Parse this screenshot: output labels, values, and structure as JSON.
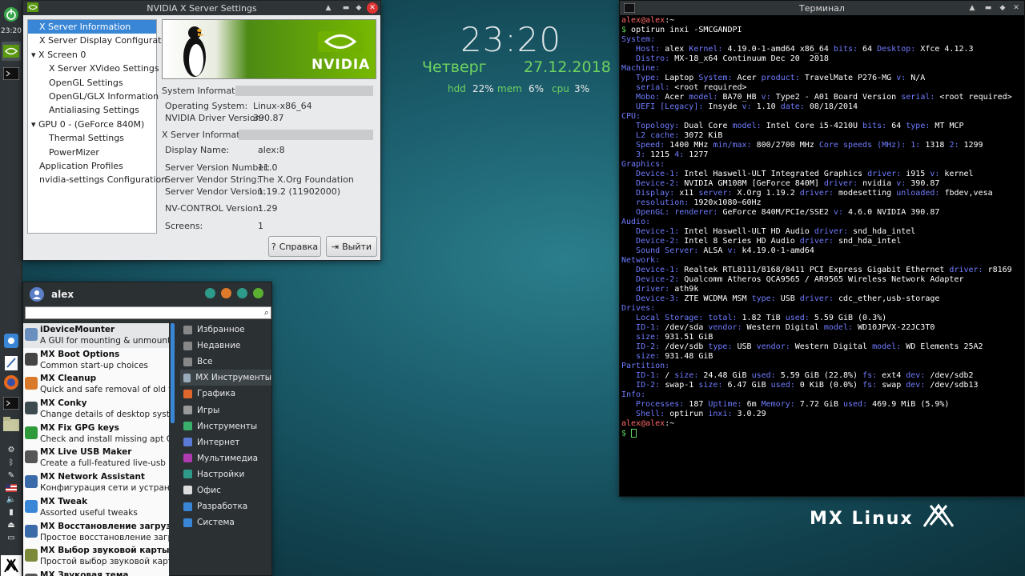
{
  "panel": {
    "clock": "23:20"
  },
  "nvidia": {
    "title": "NVIDIA X Server Settings",
    "tree": [
      {
        "label": "X Server Information",
        "indent": 0,
        "exp": "",
        "sel": true
      },
      {
        "label": "X Server Display Configuration",
        "indent": 0,
        "exp": ""
      },
      {
        "label": "X Screen 0",
        "indent": 0,
        "exp": "▾"
      },
      {
        "label": "X Server XVideo Settings",
        "indent": 2,
        "exp": ""
      },
      {
        "label": "OpenGL Settings",
        "indent": 2,
        "exp": ""
      },
      {
        "label": "OpenGL/GLX Information",
        "indent": 2,
        "exp": ""
      },
      {
        "label": "Antialiasing Settings",
        "indent": 2,
        "exp": ""
      },
      {
        "label": "GPU 0 - (GeForce 840M)",
        "indent": 0,
        "exp": "▾"
      },
      {
        "label": "Thermal Settings",
        "indent": 2,
        "exp": ""
      },
      {
        "label": "PowerMizer",
        "indent": 2,
        "exp": ""
      },
      {
        "label": "Application Profiles",
        "indent": 0,
        "exp": ""
      },
      {
        "label": "nvidia-settings Configuration",
        "indent": 0,
        "exp": ""
      }
    ],
    "banner_text": "NVIDIA",
    "sys_section": "System Information",
    "xs_section": "X Server Information",
    "rows": {
      "os_l": "Operating System:",
      "os_v": "Linux-x86_64",
      "drv_l": "NVIDIA Driver Version:",
      "drv_v": "390.87",
      "disp_l": "Display Name:",
      "disp_v": "alex:8",
      "svn_l": "Server Version Number:",
      "svn_v": "11.0",
      "svs_l": "Server Vendor String:",
      "svs_v": "The X.Org Foundation",
      "svv_l": "Server Vendor Version:",
      "svv_v": "1.19.2 (11902000)",
      "nvc_l": "NV-CONTROL Version:",
      "nvc_v": "1.29",
      "scr_l": "Screens:",
      "scr_v": "1"
    },
    "help_btn": "Справка",
    "quit_btn": "Выйти"
  },
  "conky": {
    "time": "23:20",
    "day": "Четверг",
    "date": "27.12.2018",
    "hdd_l": "hdd",
    "hdd_v": "22%",
    "mem_l": "mem",
    "mem_v": "6%",
    "cpu_l": "cpu",
    "cpu_v": "3%"
  },
  "terminal": {
    "title": "Терминал",
    "lines": [
      [
        [
          "u",
          "alex@alex"
        ],
        [
          "w",
          ":~"
        ]
      ],
      [
        [
          "g",
          "$ "
        ],
        [
          "w",
          "optirun inxi -SMCGANDPI"
        ]
      ],
      [
        [
          "k",
          "System:"
        ]
      ],
      [
        [
          "k",
          "   Host: "
        ],
        [
          "w",
          "alex "
        ],
        [
          "k",
          "Kernel: "
        ],
        [
          "w",
          "4.19.0-1-amd64 x86_64 "
        ],
        [
          "k",
          "bits: "
        ],
        [
          "w",
          "64 "
        ],
        [
          "k",
          "Desktop: "
        ],
        [
          "w",
          "Xfce 4.12.3"
        ]
      ],
      [
        [
          "k",
          "   Distro: "
        ],
        [
          "w",
          "MX-18_x64 Continuum Dec 20  2018"
        ]
      ],
      [
        [
          "k",
          "Machine:"
        ]
      ],
      [
        [
          "k",
          "   Type: "
        ],
        [
          "w",
          "Laptop "
        ],
        [
          "k",
          "System: "
        ],
        [
          "w",
          "Acer "
        ],
        [
          "k",
          "product: "
        ],
        [
          "w",
          "TravelMate P276-MG "
        ],
        [
          "k",
          "v: "
        ],
        [
          "w",
          "N/A"
        ]
      ],
      [
        [
          "k",
          "   serial: "
        ],
        [
          "w",
          "<root required>"
        ]
      ],
      [
        [
          "k",
          "   Mobo: "
        ],
        [
          "w",
          "Acer "
        ],
        [
          "k",
          "model: "
        ],
        [
          "w",
          "BA70_HB "
        ],
        [
          "k",
          "v: "
        ],
        [
          "w",
          "Type2 - A01 Board Version "
        ],
        [
          "k",
          "serial: "
        ],
        [
          "w",
          "<root required>"
        ]
      ],
      [
        [
          "k",
          "   UEFI [Legacy]: "
        ],
        [
          "w",
          "Insyde "
        ],
        [
          "k",
          "v: "
        ],
        [
          "w",
          "1.10 "
        ],
        [
          "k",
          "date: "
        ],
        [
          "w",
          "08/18/2014"
        ]
      ],
      [
        [
          "k",
          "CPU:"
        ]
      ],
      [
        [
          "k",
          "   Topology: "
        ],
        [
          "w",
          "Dual Core "
        ],
        [
          "k",
          "model: "
        ],
        [
          "w",
          "Intel Core i5-4210U "
        ],
        [
          "k",
          "bits: "
        ],
        [
          "w",
          "64 "
        ],
        [
          "k",
          "type: "
        ],
        [
          "w",
          "MT MCP"
        ]
      ],
      [
        [
          "k",
          "   L2 cache: "
        ],
        [
          "w",
          "3072 KiB"
        ]
      ],
      [
        [
          "k",
          "   Speed: "
        ],
        [
          "w",
          "1400 MHz "
        ],
        [
          "k",
          "min/max: "
        ],
        [
          "w",
          "800/2700 MHz "
        ],
        [
          "k",
          "Core speeds (MHz): 1: "
        ],
        [
          "w",
          "1318 "
        ],
        [
          "k",
          "2: "
        ],
        [
          "w",
          "1299"
        ]
      ],
      [
        [
          "k",
          "   3: "
        ],
        [
          "w",
          "1215 "
        ],
        [
          "k",
          "4: "
        ],
        [
          "w",
          "1277"
        ]
      ],
      [
        [
          "k",
          "Graphics:"
        ]
      ],
      [
        [
          "k",
          "   Device-1: "
        ],
        [
          "w",
          "Intel Haswell-ULT Integrated Graphics "
        ],
        [
          "k",
          "driver: "
        ],
        [
          "w",
          "i915 "
        ],
        [
          "k",
          "v: "
        ],
        [
          "w",
          "kernel"
        ]
      ],
      [
        [
          "k",
          "   Device-2: "
        ],
        [
          "w",
          "NVIDIA GM108M [GeForce 840M] "
        ],
        [
          "k",
          "driver: "
        ],
        [
          "w",
          "nvidia "
        ],
        [
          "k",
          "v: "
        ],
        [
          "w",
          "390.87"
        ]
      ],
      [
        [
          "k",
          "   Display: "
        ],
        [
          "w",
          "x11 "
        ],
        [
          "k",
          "server: "
        ],
        [
          "w",
          "X.Org 1.19.2 "
        ],
        [
          "k",
          "driver: "
        ],
        [
          "w",
          "modesetting "
        ],
        [
          "k",
          "unloaded: "
        ],
        [
          "w",
          "fbdev,vesa"
        ]
      ],
      [
        [
          "k",
          "   resolution: "
        ],
        [
          "w",
          "1920x1080~60Hz"
        ]
      ],
      [
        [
          "k",
          "   OpenGL: renderer: "
        ],
        [
          "w",
          "GeForce 840M/PCIe/SSE2 "
        ],
        [
          "k",
          "v: "
        ],
        [
          "w",
          "4.6.0 NVIDIA 390.87"
        ]
      ],
      [
        [
          "k",
          "Audio:"
        ]
      ],
      [
        [
          "k",
          "   Device-1: "
        ],
        [
          "w",
          "Intel Haswell-ULT HD Audio "
        ],
        [
          "k",
          "driver: "
        ],
        [
          "w",
          "snd_hda_intel"
        ]
      ],
      [
        [
          "k",
          "   Device-2: "
        ],
        [
          "w",
          "Intel 8 Series HD Audio "
        ],
        [
          "k",
          "driver: "
        ],
        [
          "w",
          "snd_hda_intel"
        ]
      ],
      [
        [
          "k",
          "   Sound Server: "
        ],
        [
          "w",
          "ALSA "
        ],
        [
          "k",
          "v: "
        ],
        [
          "w",
          "k4.19.0-1-amd64"
        ]
      ],
      [
        [
          "k",
          "Network:"
        ]
      ],
      [
        [
          "k",
          "   Device-1: "
        ],
        [
          "w",
          "Realtek RTL8111/8168/8411 PCI Express Gigabit Ethernet "
        ],
        [
          "k",
          "driver: "
        ],
        [
          "w",
          "r8169"
        ]
      ],
      [
        [
          "k",
          "   Device-2: "
        ],
        [
          "w",
          "Qualcomm Atheros QCA9565 / AR9565 Wireless Network Adapter"
        ]
      ],
      [
        [
          "k",
          "   driver: "
        ],
        [
          "w",
          "ath9k"
        ]
      ],
      [
        [
          "k",
          "   Device-3: "
        ],
        [
          "w",
          "ZTE WCDMA MSM "
        ],
        [
          "k",
          "type: "
        ],
        [
          "w",
          "USB "
        ],
        [
          "k",
          "driver: "
        ],
        [
          "w",
          "cdc_ether,usb-storage"
        ]
      ],
      [
        [
          "k",
          "Drives:"
        ]
      ],
      [
        [
          "k",
          "   Local Storage: total: "
        ],
        [
          "w",
          "1.82 TiB "
        ],
        [
          "k",
          "used: "
        ],
        [
          "w",
          "5.59 GiB (0.3%)"
        ]
      ],
      [
        [
          "k",
          "   ID-1: "
        ],
        [
          "w",
          "/dev/sda "
        ],
        [
          "k",
          "vendor: "
        ],
        [
          "w",
          "Western Digital "
        ],
        [
          "k",
          "model: "
        ],
        [
          "w",
          "WD10JPVX-22JC3T0"
        ]
      ],
      [
        [
          "k",
          "   size: "
        ],
        [
          "w",
          "931.51 GiB"
        ]
      ],
      [
        [
          "k",
          "   ID-2: "
        ],
        [
          "w",
          "/dev/sdb "
        ],
        [
          "k",
          "type: "
        ],
        [
          "w",
          "USB "
        ],
        [
          "k",
          "vendor: "
        ],
        [
          "w",
          "Western Digital "
        ],
        [
          "k",
          "model: "
        ],
        [
          "w",
          "WD Elements 25A2"
        ]
      ],
      [
        [
          "k",
          "   size: "
        ],
        [
          "w",
          "931.48 GiB"
        ]
      ],
      [
        [
          "k",
          "Partition:"
        ]
      ],
      [
        [
          "k",
          "   ID-1: "
        ],
        [
          "w",
          "/ "
        ],
        [
          "k",
          "size: "
        ],
        [
          "w",
          "24.48 GiB "
        ],
        [
          "k",
          "used: "
        ],
        [
          "w",
          "5.59 GiB (22.8%) "
        ],
        [
          "k",
          "fs: "
        ],
        [
          "w",
          "ext4 "
        ],
        [
          "k",
          "dev: "
        ],
        [
          "w",
          "/dev/sdb2"
        ]
      ],
      [
        [
          "k",
          "   ID-2: "
        ],
        [
          "w",
          "swap-1 "
        ],
        [
          "k",
          "size: "
        ],
        [
          "w",
          "6.47 GiB "
        ],
        [
          "k",
          "used: "
        ],
        [
          "w",
          "0 KiB (0.0%) "
        ],
        [
          "k",
          "fs: "
        ],
        [
          "w",
          "swap "
        ],
        [
          "k",
          "dev: "
        ],
        [
          "w",
          "/dev/sdb13"
        ]
      ],
      [
        [
          "k",
          "Info:"
        ]
      ],
      [
        [
          "k",
          "   Processes: "
        ],
        [
          "w",
          "187 "
        ],
        [
          "k",
          "Uptime: "
        ],
        [
          "w",
          "6m "
        ],
        [
          "k",
          "Memory: "
        ],
        [
          "w",
          "7.72 GiB "
        ],
        [
          "k",
          "used: "
        ],
        [
          "w",
          "469.9 MiB (5.9%)"
        ]
      ],
      [
        [
          "k",
          "   Shell: "
        ],
        [
          "w",
          "optirun "
        ],
        [
          "k",
          "inxi: "
        ],
        [
          "w",
          "3.0.29"
        ]
      ],
      [
        [
          "u",
          "alex@alex"
        ],
        [
          "w",
          ":~"
        ]
      ],
      [
        [
          "g",
          "$ "
        ]
      ]
    ]
  },
  "menu": {
    "user": "alex",
    "search_placeholder": "",
    "apps": [
      {
        "name": "iDeviceMounter",
        "desc": "A GUI for mounting & unmounting...",
        "icon": "#6a8fbf"
      },
      {
        "name": "MX Boot Options",
        "desc": "Common start-up choices",
        "icon": "#444"
      },
      {
        "name": "MX Cleanup",
        "desc": "Quick and safe removal of old files",
        "icon": "#d97a2b"
      },
      {
        "name": "MX Conky",
        "desc": "Change details of desktop system...",
        "icon": "#3d4a4f"
      },
      {
        "name": "MX Fix GPG keys",
        "desc": "Check and install missing apt GP...",
        "icon": "#2e9a3a"
      },
      {
        "name": "MX Live USB Maker",
        "desc": "Create a full-featured live-usb",
        "icon": "#555"
      },
      {
        "name": "MX Network Assistant",
        "desc": "Конфигурация сети и устранени...",
        "icon": "#3a6aa8"
      },
      {
        "name": "MX Tweak",
        "desc": "Assorted useful tweaks",
        "icon": "#3a86d6"
      },
      {
        "name": "MX Восстановление загрузчика",
        "desc": "Простое восстановление загруз...",
        "icon": "#3a6aa8"
      },
      {
        "name": "MX Выбор звуковой карты",
        "desc": "Простой выбор звуковой карты ...",
        "icon": "#7a8a3a"
      },
      {
        "name": "MX Звуковая тема",
        "desc": "",
        "icon": "#555"
      }
    ],
    "cats": [
      {
        "label": "Избранное",
        "color": "#888",
        "sel": false
      },
      {
        "label": "Недавние",
        "color": "#888",
        "sel": false
      },
      {
        "label": "Все",
        "color": "#888",
        "sel": false
      },
      {
        "label": "MX Инструменты",
        "color": "#9ab",
        "sel": true
      },
      {
        "label": "Графика",
        "color": "#e0662b",
        "sel": false
      },
      {
        "label": "Игры",
        "color": "#999",
        "sel": false
      },
      {
        "label": "Инструменты",
        "color": "#3ab06a",
        "sel": false
      },
      {
        "label": "Интернет",
        "color": "#5a7ad6",
        "sel": false
      },
      {
        "label": "Мультимедиа",
        "color": "#b03ab0",
        "sel": false
      },
      {
        "label": "Настройки",
        "color": "#2e9a8a",
        "sel": false
      },
      {
        "label": "Офис",
        "color": "#ddd",
        "sel": false
      },
      {
        "label": "Разработка",
        "color": "#3a86d6",
        "sel": false
      },
      {
        "label": "Система",
        "color": "#3a86d6",
        "sel": false
      }
    ]
  },
  "desktop": {
    "brand": "MX Linux"
  }
}
